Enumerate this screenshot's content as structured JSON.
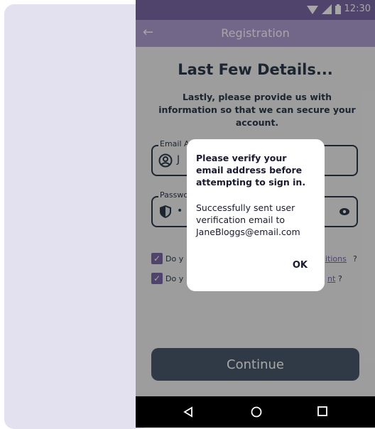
{
  "status_bar": {
    "time": "12:30"
  },
  "app_bar": {
    "title": "Registration"
  },
  "page": {
    "heading": "Last Few Details...",
    "subtext": "Lastly, please provide us with information so that we can secure your account."
  },
  "email_field": {
    "label": "Email A",
    "value": "J"
  },
  "password_field": {
    "label": "Passwo",
    "value": "•"
  },
  "checkbox_terms": {
    "text": "Do y",
    "link": "itions",
    "suffix": "?"
  },
  "checkbox_privacy": {
    "text": "Do y",
    "link": "nt",
    "suffix": "?"
  },
  "continue_button": {
    "label": "Continue"
  },
  "dialog": {
    "title": "Please verify your email address before attempting to sign in.",
    "message": "Successfully sent user\nverification email to\nJaneBloggs@email.com",
    "ok_label": "OK"
  },
  "colors": {
    "status_bar": "#7b69a6",
    "app_bar": "#b09ed1",
    "primary_text": "#2b3a4a",
    "button": "#4a5a6c",
    "accent": "#7b69a6"
  },
  "icons": [
    "wifi-icon",
    "signal-icon",
    "battery-icon",
    "back-arrow-icon",
    "person-circle-icon",
    "shield-icon",
    "eye-icon",
    "checkbox-checked-icon",
    "nav-back-icon",
    "nav-home-icon",
    "nav-recents-icon"
  ]
}
